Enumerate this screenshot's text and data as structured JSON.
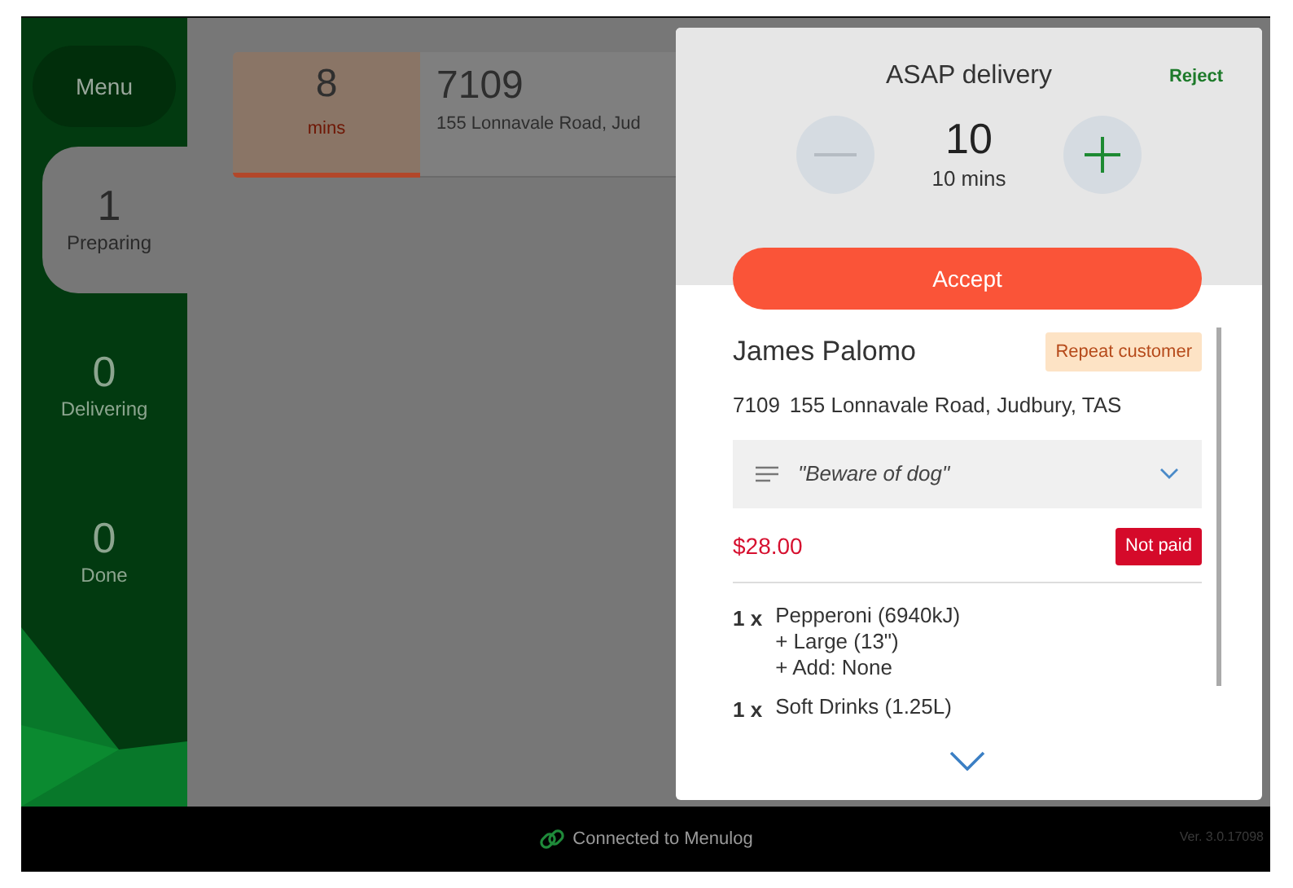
{
  "sidebar": {
    "menu_button": "Menu",
    "tabs": [
      {
        "count": "1",
        "label": "Preparing",
        "selected": true
      },
      {
        "count": "0",
        "label": "Delivering",
        "selected": false
      },
      {
        "count": "0",
        "label": "Done",
        "selected": false
      }
    ]
  },
  "orders": [
    {
      "timer_value": "8",
      "timer_unit": "mins",
      "number": "7109",
      "address": "155 Lonnavale Road, Jud"
    }
  ],
  "dialog": {
    "title": "ASAP delivery",
    "reject": "Reject",
    "stepper": {
      "value": "10",
      "caption": "10 mins"
    },
    "accept": "Accept",
    "customer": {
      "name": "James Palomo",
      "tag": "Repeat customer",
      "order_number": "7109",
      "address": "155 Lonnavale Road, Judbury, TAS"
    },
    "note": {
      "text": "\"Beware of dog\"",
      "expanded": false
    },
    "total": "$28.00",
    "payment_status": "Not paid",
    "items": [
      {
        "quantity": "1 x",
        "name": "Pepperoni (6940kJ)",
        "options": [
          "+ Large (13\")",
          "+ Add: None"
        ]
      },
      {
        "quantity": "1 x",
        "name": "Soft Drinks (1.25L)"
      }
    ]
  },
  "status_bar": {
    "connection": "Connected to Menulog",
    "version": "Ver. 3.0.17098"
  }
}
